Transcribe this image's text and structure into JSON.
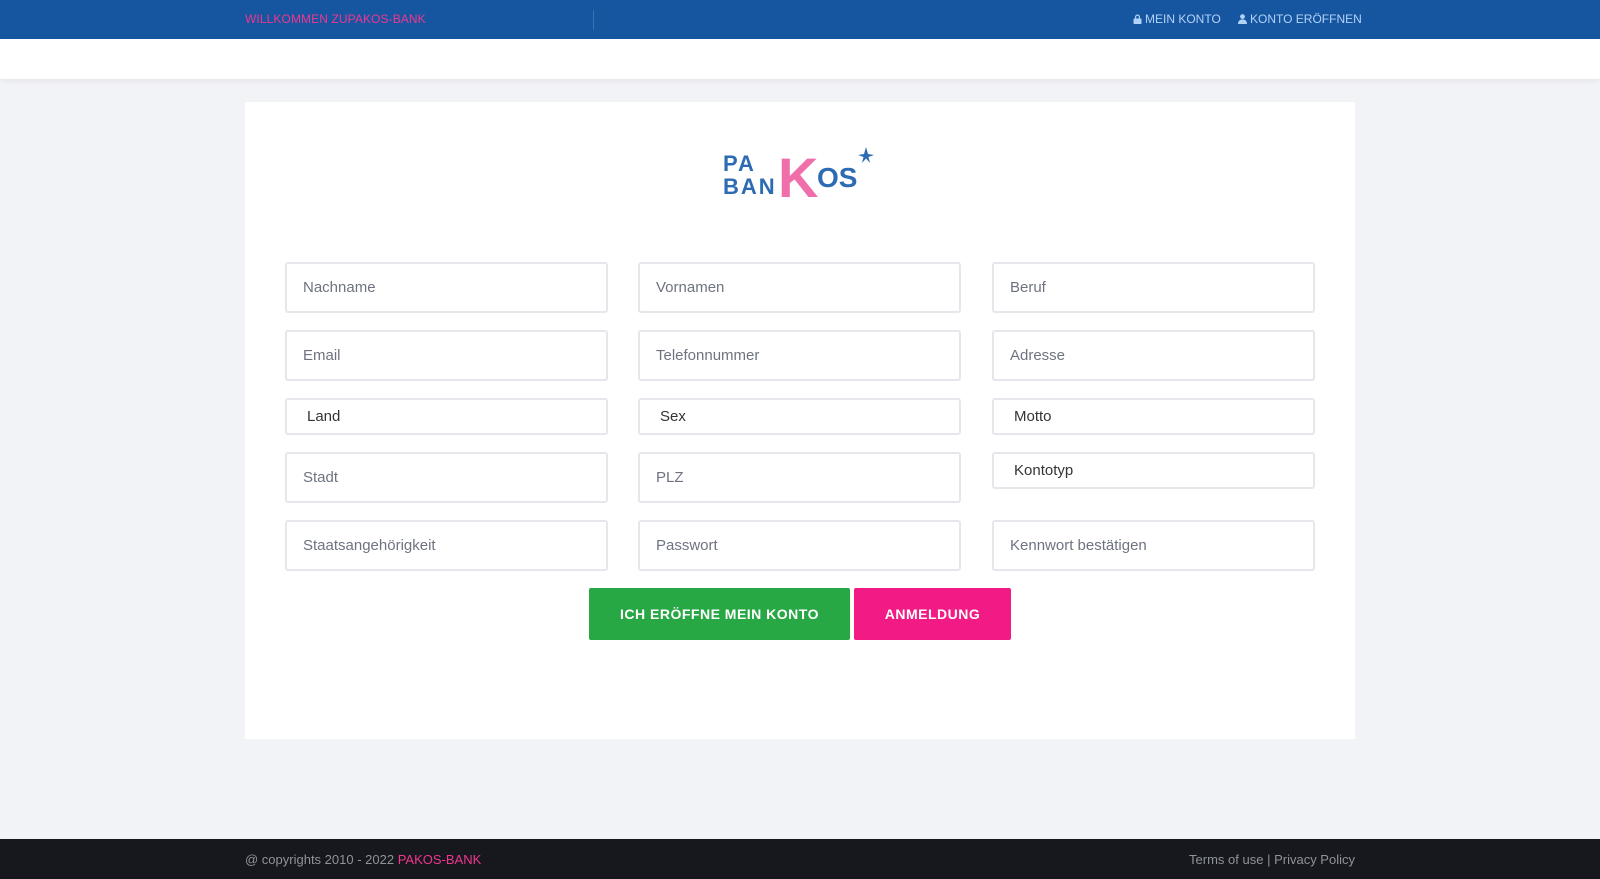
{
  "header": {
    "welcome": "WILLKOMMEN ZUPAKOS-BANK",
    "my_account": "MEIN KONTO",
    "open_account": "KONTO ERÖFFNEN",
    "bar_color": "#1656a1",
    "accent_color": "#f0368f"
  },
  "logo": {
    "line1": "PA",
    "big_letter": "K",
    "line2": "BAN",
    "suffix": "OS"
  },
  "form": {
    "nachname": "Nachname",
    "vornamen": "Vornamen",
    "beruf": "Beruf",
    "email": "Email",
    "telefon": "Telefonnummer",
    "adresse": "Adresse",
    "land": "Land",
    "sex": "Sex",
    "motto": "Motto",
    "stadt": "Stadt",
    "plz": "PLZ",
    "kontotyp": "Kontotyp",
    "staatsangehoerigkeit": "Staatsangehörigkeit",
    "passwort": "Passwort",
    "kennwort": "Kennwort bestätigen"
  },
  "buttons": {
    "open": "ICH ERÖFFNE MEIN KONTO",
    "login": "ANMELDUNG",
    "open_color": "#28a745",
    "login_color": "#f21b86"
  },
  "footer": {
    "copyright": "@ copyrights 2010 - 2022",
    "brand": "PAKOS-BANK",
    "terms": "Terms of use",
    "separator": "|",
    "privacy": "Privacy Policy"
  }
}
